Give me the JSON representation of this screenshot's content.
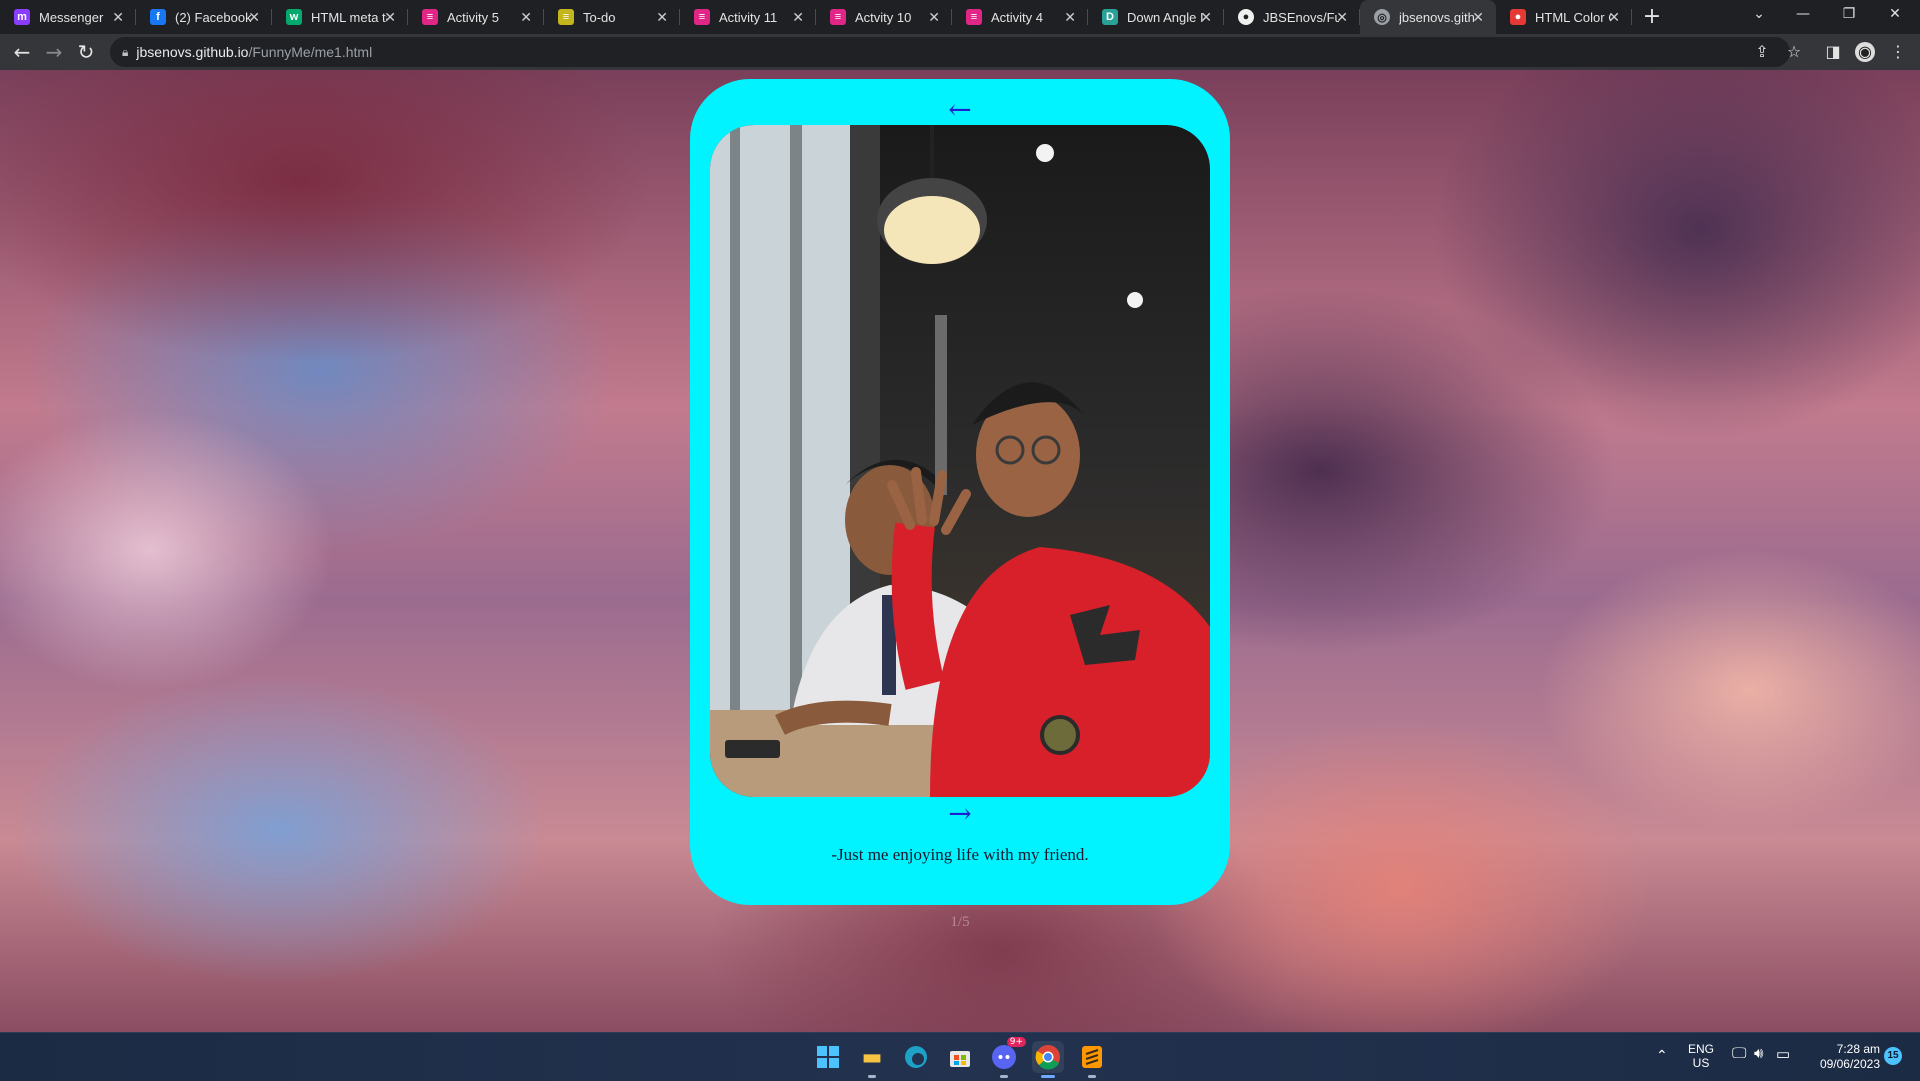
{
  "browser": {
    "tabs": [
      {
        "label": "Messenger",
        "icon": "messenger-icon",
        "color": "#8a3cff",
        "glyph": "m"
      },
      {
        "label": "(2) Facebook",
        "icon": "facebook-icon",
        "color": "#1877f2",
        "glyph": "f"
      },
      {
        "label": "HTML meta ta",
        "icon": "w3schools-icon",
        "color": "#04aa6d",
        "glyph": "w"
      },
      {
        "label": "Activity 5",
        "icon": "classroom-icon",
        "color": "#e02687",
        "glyph": "≡"
      },
      {
        "label": "To-do",
        "icon": "classroom-icon",
        "color": "#c5b51d",
        "glyph": "≡"
      },
      {
        "label": "Activity 11",
        "icon": "classroom-icon",
        "color": "#e02687",
        "glyph": "≡"
      },
      {
        "label": "Actvity 10",
        "icon": "classroom-icon",
        "color": "#e02687",
        "glyph": "≡"
      },
      {
        "label": "Activity 4",
        "icon": "classroom-icon",
        "color": "#e02687",
        "glyph": "≡"
      },
      {
        "label": "Down Angle I",
        "icon": "fontawesome-icon",
        "color": "#2aa198",
        "glyph": "D"
      },
      {
        "label": "JBSEnovs/Fun",
        "icon": "github-icon",
        "color": "#f0f0f0",
        "glyph": "●"
      },
      {
        "label": "jbsenovs.gith",
        "icon": "globe-icon",
        "color": "#9aa0a6",
        "glyph": "◎",
        "active": true
      },
      {
        "label": "HTML Color C",
        "icon": "htmlcolor-icon",
        "color": "#e53935",
        "glyph": "●"
      }
    ],
    "new_tab": "+",
    "url_host": "jbsenovs.github.io",
    "url_path": "/FunnyMe/me1.html"
  },
  "page": {
    "prev_arrow": "←",
    "next_arrow": "→",
    "caption": "-Just me enjoying life with my friend.",
    "counter": "1/5"
  },
  "taskbar": {
    "lang_top": "ENG",
    "lang_bottom": "US",
    "time": "7:28 am",
    "date": "09/06/2023",
    "notification_count": "15",
    "discord_badge": "9+"
  },
  "colors": {
    "card": "#00f3ff",
    "arrow": "#1f1fd0",
    "tab_bar": "#1f2023",
    "toolbar": "#35363a"
  }
}
